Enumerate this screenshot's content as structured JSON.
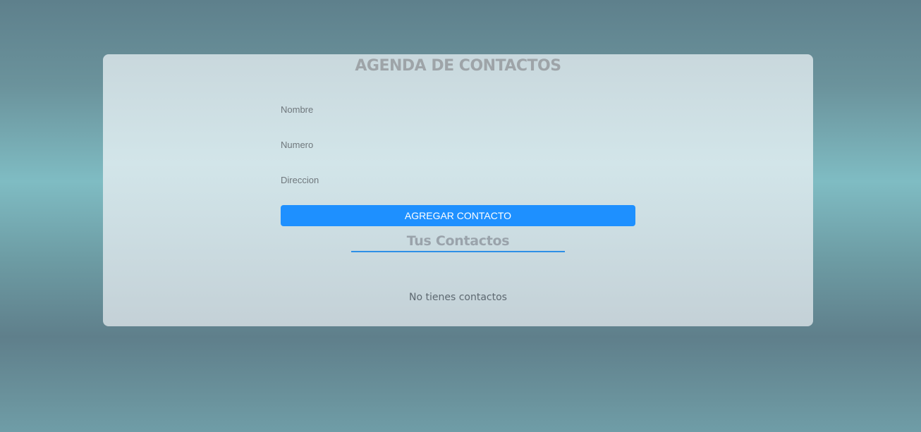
{
  "app": {
    "title": "AGENDA DE CONTACTOS"
  },
  "form": {
    "nombre_placeholder": "Nombre",
    "numero_placeholder": "Numero",
    "direccion_placeholder": "Direccion",
    "submit_label": "AGREGAR CONTACTO"
  },
  "contacts": {
    "heading": "Tus Contactos",
    "empty_message": "No tienes contactos",
    "items": []
  },
  "colors": {
    "accent": "#1e90ff",
    "heading_text": "#9ea4a8",
    "underline": "#2d8fe6"
  }
}
